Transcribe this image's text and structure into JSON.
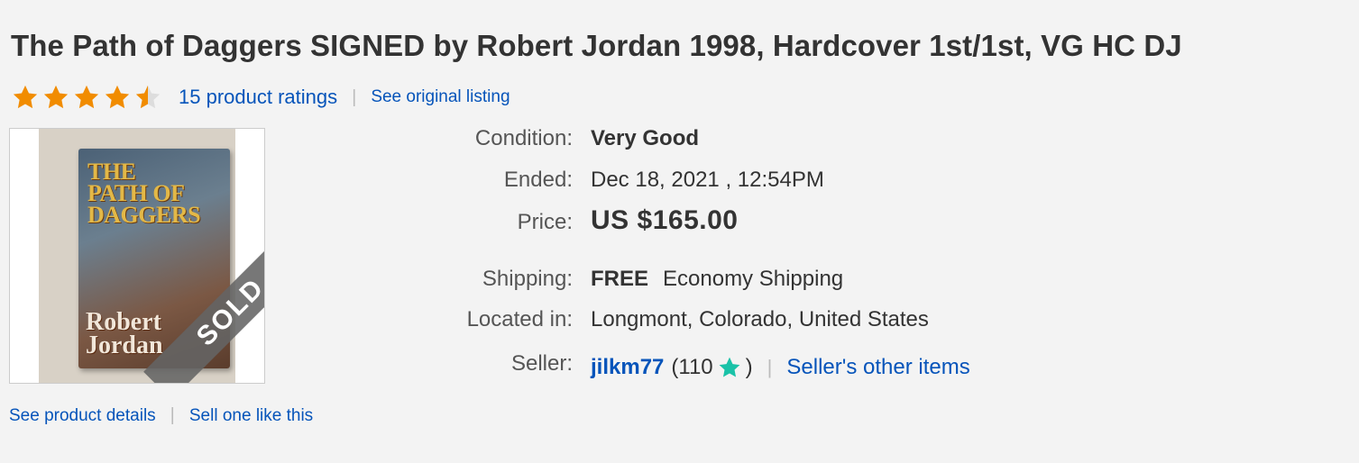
{
  "title": "The Path of Daggers SIGNED by Robert Jordan 1998, Hardcover 1st/1st, VG HC DJ",
  "rating": {
    "stars": 4.5,
    "ratings_link": "15 product ratings",
    "separator": "|",
    "original_listing_link": "See original listing"
  },
  "image": {
    "book_title": "THE PATH OF DAGGERS",
    "book_author": "Robert Jordan",
    "sold_label": "SOLD"
  },
  "details": {
    "condition_label": "Condition:",
    "condition_value": "Very Good",
    "ended_label": "Ended:",
    "ended_value": "Dec 18, 2021 , 12:54PM",
    "price_label": "Price:",
    "price_value": "US $165.00",
    "shipping_label": "Shipping:",
    "shipping_free": "FREE",
    "shipping_method": "Economy Shipping",
    "location_label": "Located in:",
    "location_value": "Longmont, Colorado, United States",
    "seller_label": "Seller:",
    "seller_name": "jilkm77",
    "seller_feedback_open": "(110",
    "seller_feedback_close": ")",
    "seller_separator": "|",
    "seller_other_items": "Seller's other items"
  },
  "bottom": {
    "product_details_link": "See product details",
    "separator": "|",
    "sell_one_link": "Sell one like this"
  },
  "colors": {
    "star": "#f18c00",
    "link": "#0654ba",
    "feedback_star": "#1ac2a8"
  }
}
